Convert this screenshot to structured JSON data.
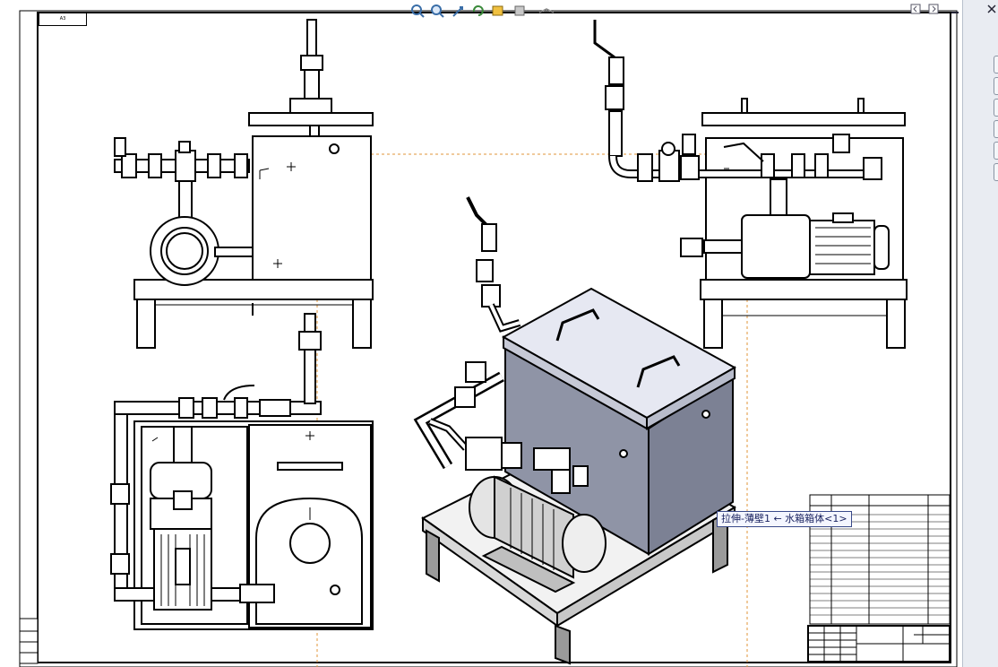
{
  "toolbar": {
    "tools": [
      "zoom-to-fit-icon",
      "zoom-area-icon",
      "pan-icon",
      "rotate-icon",
      "section-view-icon",
      "display-style-icon",
      "view-orientation-icon"
    ]
  },
  "sheet": {
    "tab_label": "A3"
  },
  "tooltip": {
    "text": "拉伸-薄壁1 ← 水箱箱体<1>"
  },
  "colors": {
    "sheet_bg": "#ffffff",
    "line": "#000000",
    "tank_fill": "#8f94a6",
    "tank_lid": "#e6e8f2",
    "dash_orange": "#e0953a",
    "tooltip_border": "#3a4a8a"
  }
}
